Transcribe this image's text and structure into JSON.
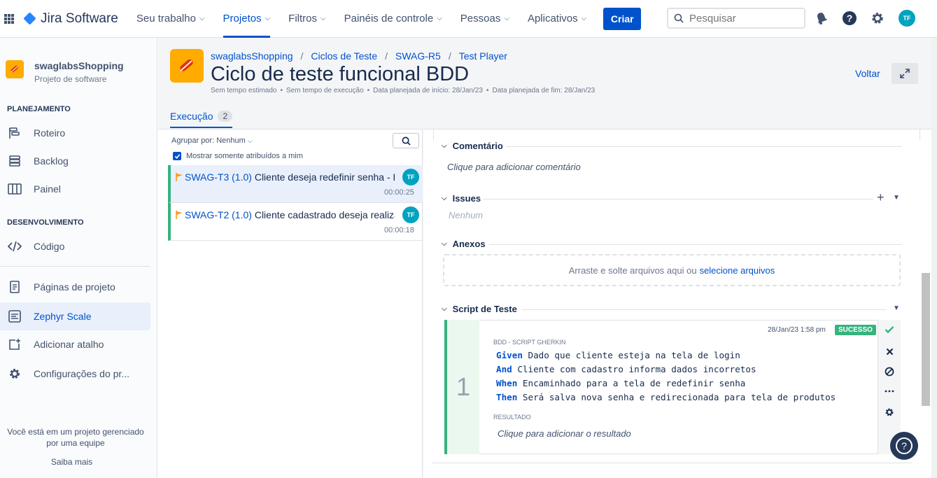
{
  "topnav": {
    "brand": "Jira Software",
    "items": [
      {
        "label": "Seu trabalho"
      },
      {
        "label": "Projetos"
      },
      {
        "label": "Filtros"
      },
      {
        "label": "Painéis de controle"
      },
      {
        "label": "Pessoas"
      },
      {
        "label": "Aplicativos"
      }
    ],
    "active_item": "Projetos",
    "create_label": "Criar",
    "search_placeholder": "Pesquisar",
    "avatar_initials": "TF"
  },
  "sidebar": {
    "project_name": "swaglabsShopping",
    "project_type": "Projeto de software",
    "planning_heading": "PLANEJAMENTO",
    "planning_items": [
      "Roteiro",
      "Backlog",
      "Painel"
    ],
    "dev_heading": "DESENVOLVIMENTO",
    "dev_items": [
      "Código"
    ],
    "other_items": [
      "Páginas de projeto",
      "Zephyr Scale",
      "Adicionar atalho",
      "Configurações do pr..."
    ],
    "active_item": "Zephyr Scale",
    "footer_text": "Você está em um projeto gerenciado por uma equipe",
    "footer_link": "Saiba mais"
  },
  "header": {
    "breadcrumbs": [
      "swaglabsShopping",
      "Ciclos de Teste",
      "SWAG-R5",
      "Test Player"
    ],
    "title": "Ciclo de teste funcional BDD",
    "meta": [
      "Sem tempo estimado",
      "Sem tempo de execução",
      "Data planejada de início: 28/Jan/23",
      "Data planejada de fim: 28/Jan/23"
    ],
    "back_label": "Voltar",
    "tab_label": "Execução",
    "tab_count": "2"
  },
  "executions": {
    "group_by": "Agrupar por: Nenhum",
    "only_assigned": "Mostrar somente atribuídos a mim",
    "rows": [
      {
        "key": "SWAG-T3 (1.0)",
        "text": " Cliente deseja redefinir senha - BDD",
        "time": "00:00:25",
        "assignee": "TF"
      },
      {
        "key": "SWAG-T2 (1.0)",
        "text": " Cliente cadastrado deseja realizar login",
        "time": "00:00:18",
        "assignee": "TF"
      }
    ]
  },
  "detail": {
    "comment_heading": "Comentário",
    "comment_placeholder": "Clique para adicionar comentário",
    "issues_heading": "Issues",
    "issues_empty": "Nenhum",
    "attachments_heading": "Anexos",
    "dropzone_text": "Arraste e solte arquivos aqui ou",
    "dropzone_link": "selecione arquivos",
    "script_heading": "Script de Teste",
    "step": {
      "number": "1",
      "timestamp": "28/Jan/23 1:58 pm",
      "status": "SUCESSO",
      "script_label": "BDD - SCRIPT GHERKIN",
      "lines": [
        {
          "kw": "Given",
          "text": " Dado que cliente esteja na tela de login"
        },
        {
          "kw": "And",
          "text": " Cliente com cadastro informa dados incorretos"
        },
        {
          "kw": "When",
          "text": " Encaminhado para a tela de redefinir senha"
        },
        {
          "kw": "Then",
          "text": " Será salva nova senha e redirecionada para tela de produtos"
        }
      ],
      "result_label": "RESULTADO",
      "result_placeholder": "Clique para adicionar o resultado"
    }
  },
  "colors": {
    "brand": "#0052cc",
    "success": "#36b37e",
    "project_icon": "#ffab00"
  }
}
